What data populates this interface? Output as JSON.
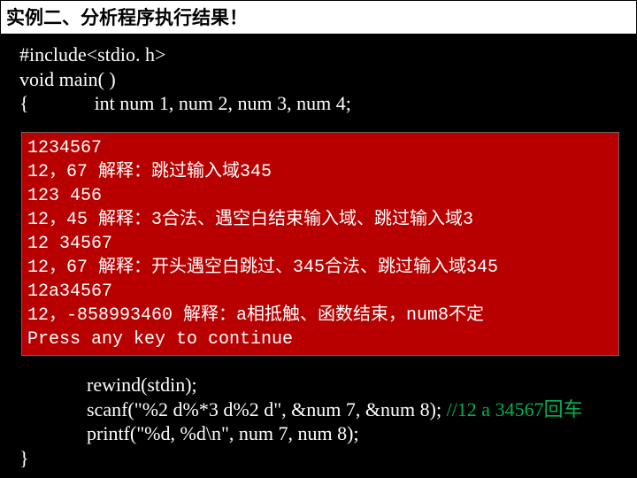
{
  "title": "实例二、分析程序执行结果！",
  "code_top": {
    "l1": "#include<stdio. h>",
    "l2": "void main( )",
    "l3_a": "{",
    "l3_b": "int num 1, num 2, num 3, num 4;"
  },
  "console": {
    "l1": "1234567",
    "l2": "12，67 解释：跳过输入域345",
    "l3": "123 456",
    "l4": "12，45 解释：3合法、遇空白结束输入域、跳过输入域3",
    "l5": "12 34567",
    "l6": "12，67 解释：开头遇空白跳过、345合法、跳过输入域345",
    "l7": "12a34567",
    "l8": "12，-858993460 解释：a相抵触、函数结束，num8不定",
    "l9": "Press any key to continue"
  },
  "code_bottom": {
    "l1": "rewind(stdin);",
    "l2_a": "scanf(\"%2 d%*3 d%2 d\", &num 7, &num 8); ",
    "l2_b": "//12 a 34567回车",
    "l3": "printf(\"%d, %d\\n\", num 7, num 8);",
    "l4": "}"
  }
}
